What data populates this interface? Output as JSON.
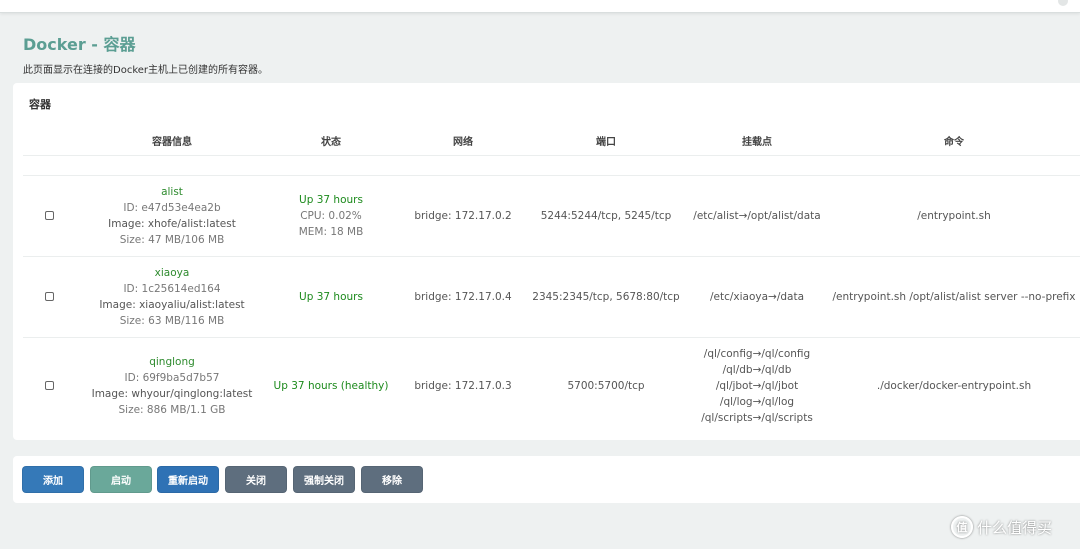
{
  "page": {
    "title": "Docker - 容器",
    "description": "此页面显示在连接的Docker主机上已创建的所有容器。"
  },
  "card": {
    "title": "容器",
    "headers": [
      "容器信息",
      "状态",
      "网络",
      "端口",
      "挂载点",
      "命令"
    ]
  },
  "containers": [
    {
      "name": "alist",
      "id": "ID: e47d53e4ea2b",
      "image": "Image: xhofe/alist:latest",
      "size": "Size: 47 MB/106 MB",
      "status": "Up 37 hours",
      "cpu": "CPU: 0.02%",
      "mem": "MEM: 18 MB",
      "network": "bridge: 172.17.0.2",
      "ports": "5244:5244/tcp, 5245/tcp",
      "mounts": [
        "/etc/alist→/opt/alist/data"
      ],
      "command": "/entrypoint.sh"
    },
    {
      "name": "xiaoya",
      "id": "ID: 1c25614ed164",
      "image": "Image: xiaoyaliu/alist:latest",
      "size": "Size: 63 MB/116 MB",
      "status": "Up 37 hours",
      "network": "bridge: 172.17.0.4",
      "ports": "2345:2345/tcp, 5678:80/tcp",
      "mounts": [
        "/etc/xiaoya→/data"
      ],
      "command": "/entrypoint.sh /opt/alist/alist server --no-prefix"
    },
    {
      "name": "qinglong",
      "id": "ID: 69f9ba5d7b57",
      "image": "Image: whyour/qinglong:latest",
      "size": "Size: 886 MB/1.1 GB",
      "status": "Up 37 hours (healthy)",
      "network": "bridge: 172.17.0.3",
      "ports": "5700:5700/tcp",
      "mounts": [
        "/ql/config→/ql/config",
        "/ql/db→/ql/db",
        "/ql/jbot→/ql/jbot",
        "/ql/log→/ql/log",
        "/ql/scripts→/ql/scripts"
      ],
      "command": "./docker/docker-entrypoint.sh"
    }
  ],
  "buttons": {
    "add": "添加",
    "start": "启动",
    "restart": "重新启动",
    "stop": "关闭",
    "kill": "强制关闭",
    "remove": "移除"
  },
  "colors": {
    "title": "#5b9e93",
    "btn_add": "#3579b8",
    "btn_start": "#6aa89a",
    "btn_restart": "#2f72b5",
    "btn_gray": "#5e6e7e"
  },
  "watermark": {
    "icon": "值",
    "text": "什么值得买"
  }
}
